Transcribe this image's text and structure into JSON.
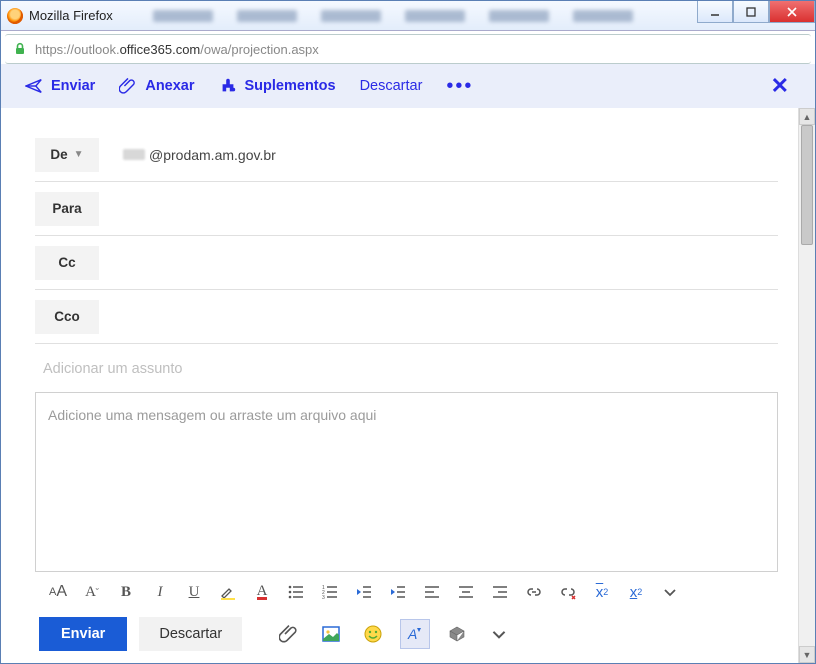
{
  "window": {
    "title": "Mozilla Firefox"
  },
  "urlbar": {
    "url_prefix": "https://outlook.",
    "url_domain": "office365.com",
    "url_path": "/owa/projection.aspx"
  },
  "cmdbar": {
    "send": "Enviar",
    "attach": "Anexar",
    "addins": "Suplementos",
    "discard": "Descartar"
  },
  "fields": {
    "from_label": "De",
    "from_value": "@prodam.am.gov.br",
    "to_label": "Para",
    "cc_label": "Cc",
    "bcc_label": "Cco",
    "subject_placeholder": "Adicionar um assunto",
    "body_placeholder": "Adicione uma mensagem ou arraste um arquivo aqui"
  },
  "actions": {
    "send": "Enviar",
    "discard": "Descartar"
  }
}
